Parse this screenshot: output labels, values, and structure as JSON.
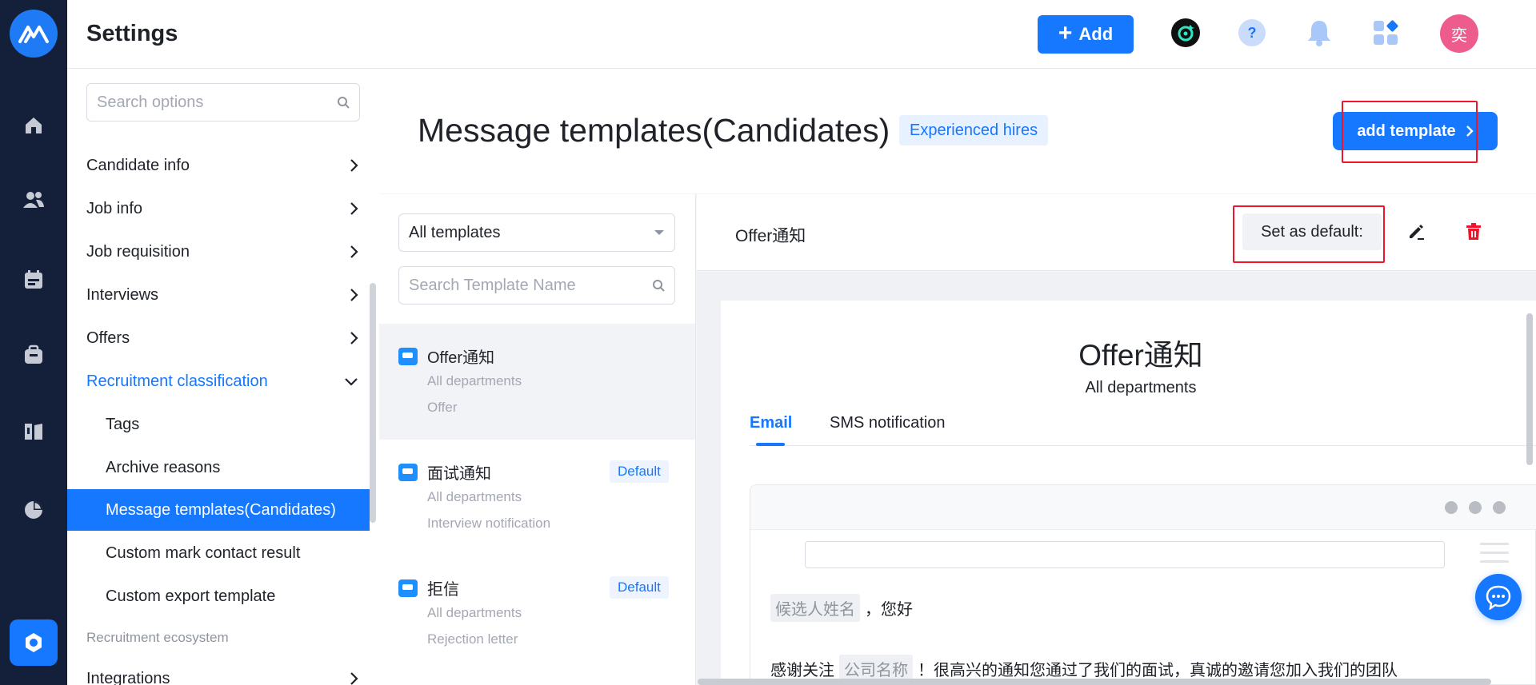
{
  "header": {
    "title": "Settings",
    "add_label": "Add",
    "avatar_text": "奕"
  },
  "sidebar": {
    "search_placeholder": "Search options",
    "items": [
      {
        "label": "Candidate info"
      },
      {
        "label": "Job info"
      },
      {
        "label": "Job requisition"
      },
      {
        "label": "Interviews"
      },
      {
        "label": "Offers"
      },
      {
        "label": "Recruitment classification"
      }
    ],
    "sub_items": [
      {
        "label": "Tags"
      },
      {
        "label": "Archive reasons"
      },
      {
        "label": "Message templates(Candidates)"
      },
      {
        "label": "Custom mark contact result"
      },
      {
        "label": "Custom export template"
      }
    ],
    "section_label": "Recruitment ecosystem",
    "bottom_item": "Integrations"
  },
  "page": {
    "title": "Message templates(Candidates)",
    "tag": "Experienced hires",
    "add_template": "add template"
  },
  "template_list": {
    "filter_value": "All templates",
    "search_placeholder": "Search Template Name",
    "items": [
      {
        "name": "Offer通知",
        "dept": "All departments",
        "type": "Offer",
        "badge": ""
      },
      {
        "name": "面试通知",
        "dept": "All departments",
        "type": "Interview notification",
        "badge": "Default"
      },
      {
        "name": "拒信",
        "dept": "All departments",
        "type": "Rejection letter",
        "badge": "Default"
      }
    ]
  },
  "detail": {
    "title": "Offer通知",
    "set_default": "Set as default:",
    "card_title": "Offer通知",
    "card_subtitle": "All departments",
    "tabs": [
      {
        "label": "Email"
      },
      {
        "label": "SMS notification"
      }
    ],
    "mail": {
      "var_candidate": "候选人姓名",
      "greeting": "，您好",
      "thanks": "感谢关注",
      "var_company": "公司名称",
      "body": "！很高兴的通知您通过了我们的面试，真诚的邀请您加入我们的团队"
    }
  },
  "colors": {
    "primary": "#1677ff",
    "rail": "#14203a",
    "highlight": "#f0152a"
  }
}
